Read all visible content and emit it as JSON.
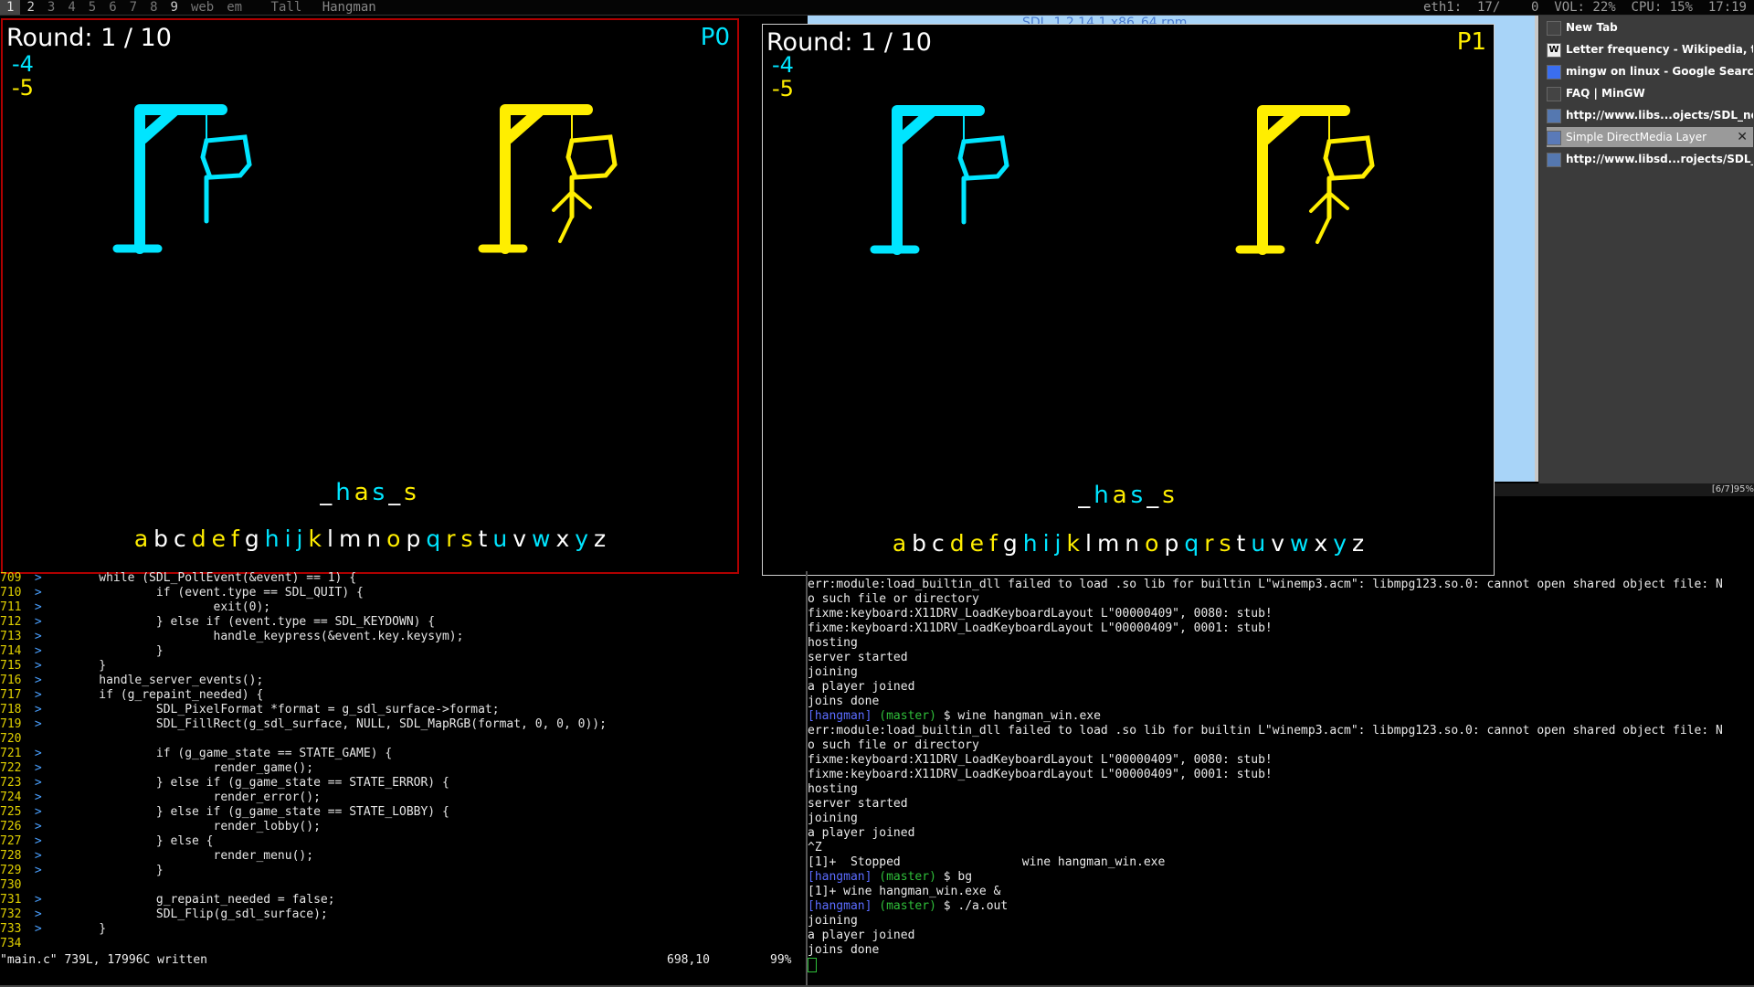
{
  "topbar": {
    "workspaces": [
      "1",
      "2",
      "3",
      "4",
      "5",
      "6",
      "7",
      "8",
      "9",
      "web",
      "em"
    ],
    "layout": "Tall",
    "window_title": "Hangman",
    "stats": "eth1:  17/    0  VOL: 22%  CPU: 15%  17:19"
  },
  "game_p0": {
    "round": "Round:  1 / 10",
    "player": "P0",
    "score_a": "-4",
    "score_b": "-5",
    "word": "_has_s",
    "letters": [
      "a",
      "b",
      "c",
      "d",
      "e",
      "f",
      "g",
      "h",
      "i",
      "j",
      "k",
      "l",
      "m",
      "n",
      "o",
      "p",
      "q",
      "r",
      "s",
      "t",
      "u",
      "v",
      "w",
      "x",
      "y",
      "z"
    ]
  },
  "game_p1": {
    "round": "Round:  1 / 10",
    "player": "P1",
    "score_a": "-4",
    "score_b": "-5",
    "word": "_has_s",
    "letters": [
      "a",
      "b",
      "c",
      "d",
      "e",
      "f",
      "g",
      "h",
      "i",
      "j",
      "k",
      "l",
      "m",
      "n",
      "o",
      "p",
      "q",
      "r",
      "s",
      "t",
      "u",
      "v",
      "w",
      "x",
      "y",
      "z"
    ]
  },
  "colors": {
    "cyan": "#00e5ff",
    "yellow": "#ffee00",
    "white": "#ffffff",
    "frame_red": "#b00000"
  },
  "letter_colors": [
    "yellow",
    "white",
    "white",
    "yellow",
    "yellow",
    "yellow",
    "white",
    "cyan",
    "cyan",
    "cyan",
    "yellow",
    "white",
    "white",
    "white",
    "yellow",
    "white",
    "cyan",
    "yellow",
    "yellow",
    "white",
    "cyan",
    "white",
    "cyan",
    "white",
    "cyan",
    "white"
  ],
  "editor": {
    "lines": [
      {
        "n": "709",
        "code": "        while (SDL_PollEvent(&event) == 1) {"
      },
      {
        "n": "710",
        "code": "                if (event.type == SDL_QUIT) {"
      },
      {
        "n": "711",
        "code": "                        exit(0);"
      },
      {
        "n": "712",
        "code": "                } else if (event.type == SDL_KEYDOWN) {"
      },
      {
        "n": "713",
        "code": "                        handle_keypress(&event.key.keysym);"
      },
      {
        "n": "714",
        "code": "                }"
      },
      {
        "n": "715",
        "code": "        }"
      },
      {
        "n": "716",
        "code": "        handle_server_events();"
      },
      {
        "n": "717",
        "code": "        if (g_repaint_needed) {"
      },
      {
        "n": "718",
        "code": "                SDL_PixelFormat *format = g_sdl_surface->format;"
      },
      {
        "n": "719",
        "code": "                SDL_FillRect(g_sdl_surface, NULL, SDL_MapRGB(format, 0, 0, 0));"
      },
      {
        "n": "720",
        "code": ""
      },
      {
        "n": "721",
        "code": "                if (g_game_state == STATE_GAME) {"
      },
      {
        "n": "722",
        "code": "                        render_game();"
      },
      {
        "n": "723",
        "code": "                } else if (g_game_state == STATE_ERROR) {"
      },
      {
        "n": "724",
        "code": "                        render_error();"
      },
      {
        "n": "725",
        "code": "                } else if (g_game_state == STATE_LOBBY) {"
      },
      {
        "n": "726",
        "code": "                        render_lobby();"
      },
      {
        "n": "727",
        "code": "                } else {"
      },
      {
        "n": "728",
        "code": "                        render_menu();"
      },
      {
        "n": "729",
        "code": "                }"
      },
      {
        "n": "730",
        "code": ""
      },
      {
        "n": "731",
        "code": "                g_repaint_needed = false;"
      },
      {
        "n": "732",
        "code": "                SDL_Flip(g_sdl_surface);"
      },
      {
        "n": "733",
        "code": "        }"
      },
      {
        "n": "734",
        "code": ""
      }
    ],
    "status_left": "\"main.c\" 739L, 17996C written",
    "status_pos": "698,10",
    "status_pct": "99%"
  },
  "terminal": {
    "lines": [
      {
        "t": "text",
        "v": "err:module:load_builtin_dll failed to load .so lib for builtin L\"winemp3.acm\": libmpg123.so.0: cannot open shared object file: N"
      },
      {
        "t": "text",
        "v": "o such file or directory"
      },
      {
        "t": "text",
        "v": "fixme:keyboard:X11DRV_LoadKeyboardLayout L\"00000409\", 0080: stub!"
      },
      {
        "t": "text",
        "v": "fixme:keyboard:X11DRV_LoadKeyboardLayout L\"00000409\", 0001: stub!"
      },
      {
        "t": "text",
        "v": "hosting"
      },
      {
        "t": "text",
        "v": "server started"
      },
      {
        "t": "text",
        "v": "joining"
      },
      {
        "t": "text",
        "v": "a player joined"
      },
      {
        "t": "text",
        "v": "joins done"
      },
      {
        "t": "prompt",
        "dir": "[hangman]",
        "branch": "(master)",
        "cmd": " $ wine hangman_win.exe"
      },
      {
        "t": "text",
        "v": "err:module:load_builtin_dll failed to load .so lib for builtin L\"winemp3.acm\": libmpg123.so.0: cannot open shared object file: N"
      },
      {
        "t": "text",
        "v": "o such file or directory"
      },
      {
        "t": "text",
        "v": "fixme:keyboard:X11DRV_LoadKeyboardLayout L\"00000409\", 0080: stub!"
      },
      {
        "t": "text",
        "v": "fixme:keyboard:X11DRV_LoadKeyboardLayout L\"00000409\", 0001: stub!"
      },
      {
        "t": "text",
        "v": "hosting"
      },
      {
        "t": "text",
        "v": "server started"
      },
      {
        "t": "text",
        "v": "joining"
      },
      {
        "t": "text",
        "v": "a player joined"
      },
      {
        "t": "text",
        "v": "^Z"
      },
      {
        "t": "text",
        "v": "[1]+  Stopped                 wine hangman_win.exe"
      },
      {
        "t": "prompt",
        "dir": "[hangman]",
        "branch": "(master)",
        "cmd": " $ bg"
      },
      {
        "t": "text",
        "v": "[1]+ wine hangman_win.exe &"
      },
      {
        "t": "prompt",
        "dir": "[hangman]",
        "branch": "(master)",
        "cmd": " $ ./a.out"
      },
      {
        "t": "text",
        "v": "joining"
      },
      {
        "t": "text",
        "v": "a player joined"
      },
      {
        "t": "text",
        "v": "joins done"
      }
    ]
  },
  "browser": {
    "page_title": "SDL_1.2.14.1.x86_64.rpm",
    "tabs": [
      {
        "label": "New Tab",
        "icon": "blank-page-icon"
      },
      {
        "label": "Letter frequency - Wikipedia, th...",
        "icon": "wikipedia-icon"
      },
      {
        "label": "mingw on linux - Google Search",
        "icon": "google-icon"
      },
      {
        "label": "FAQ | MinGW",
        "icon": "blank-page-icon"
      },
      {
        "label": "http://www.libs...ojects/SDL_net/",
        "icon": "page-icon"
      },
      {
        "label": "Simple DirectMedia Layer",
        "icon": "sdl-icon",
        "active": true
      },
      {
        "label": "http://www.libsd...rojects/SDL_ttf/",
        "icon": "page-icon"
      }
    ],
    "status": "[6/7]95%"
  }
}
